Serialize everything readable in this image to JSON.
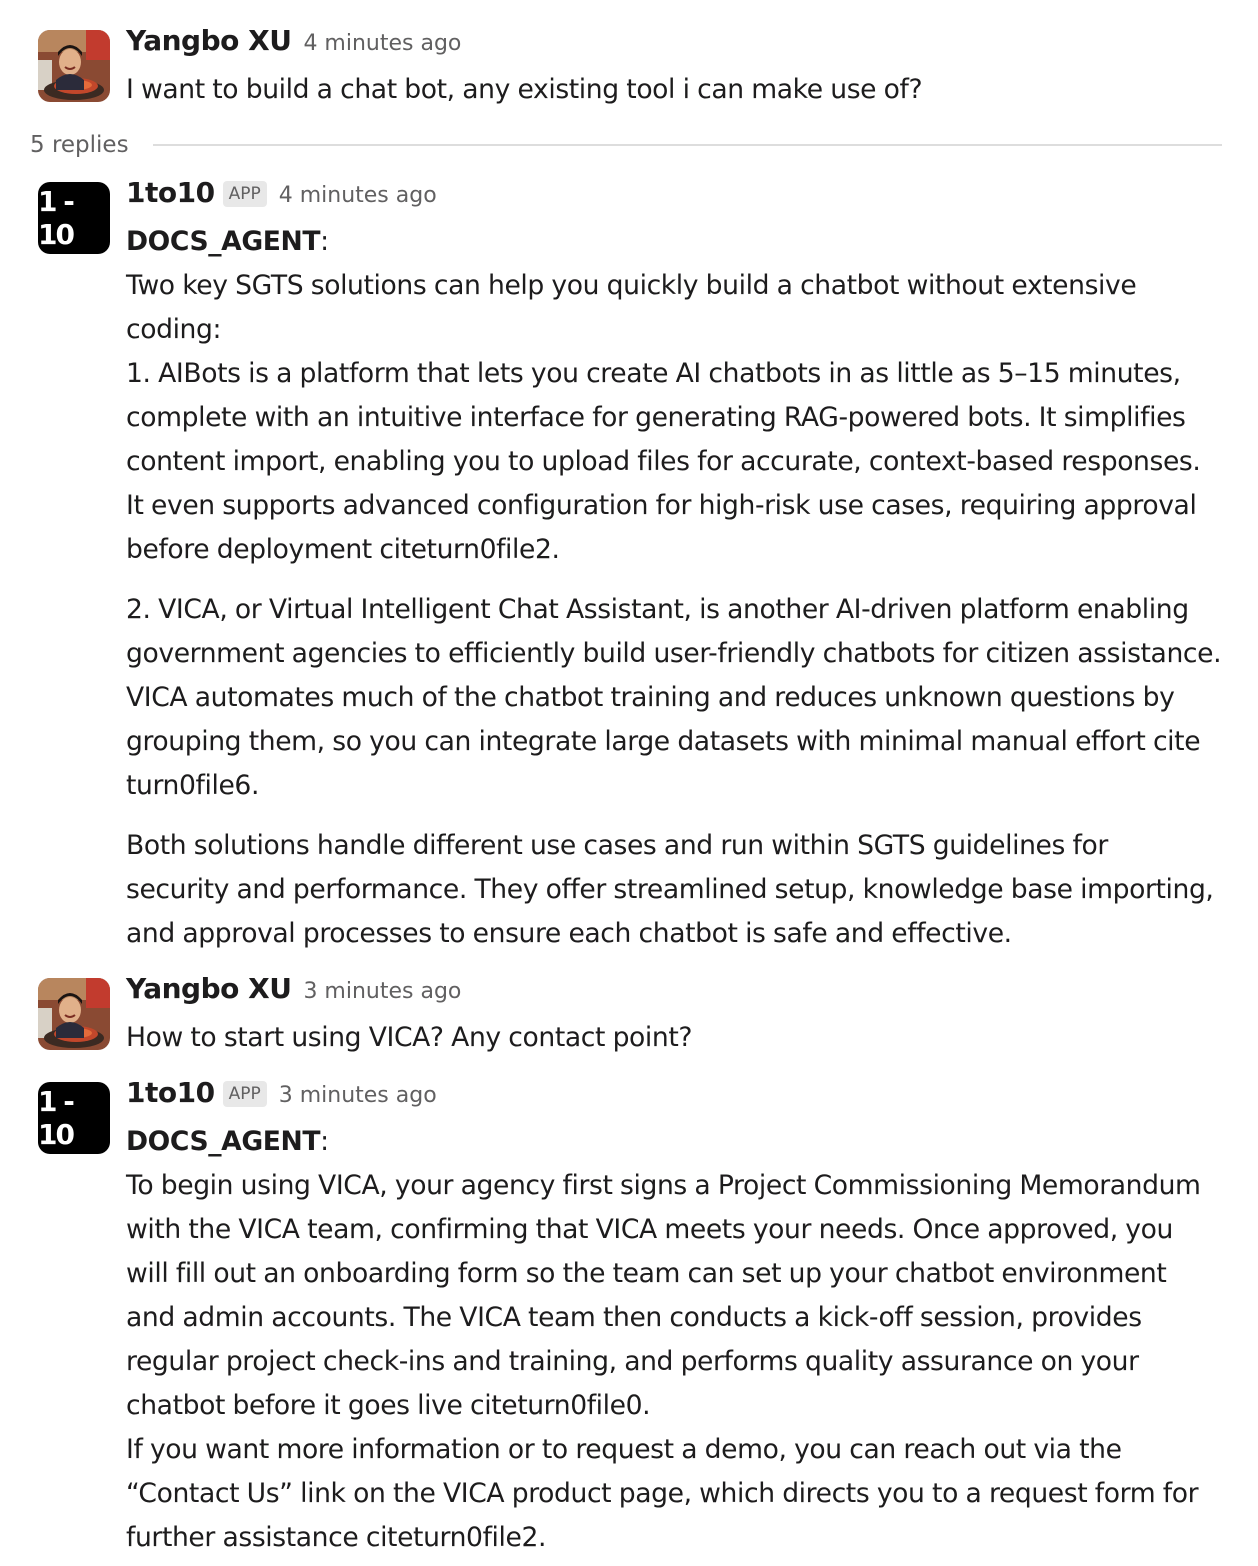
{
  "thread": {
    "parent": {
      "author": "Yangbo XU",
      "time": "4 minutes ago",
      "text": "I want to build a chat bot, any existing tool i can make use of?"
    },
    "replies_label": "5 replies"
  },
  "bot": {
    "avatar_text": "1 - 10",
    "name": "1to10",
    "badge": "APP"
  },
  "reply1": {
    "time": "4 minutes ago",
    "agent": "DOCS_AGENT",
    "colon": ":",
    "lines": [
      "Two key SGTS solutions can help you quickly build a chatbot without extensive",
      "coding:",
      "1. AIBots is a platform that lets you create AI chatbots in as little as 5–15 minutes,",
      "complete with an intuitive interface for generating RAG-powered bots. It simplifies",
      "content import, enabling you to upload files for accurate, context-based responses.",
      "It even supports advanced configuration for high-risk use cases, requiring approval",
      "before deployment citeturn0file2."
    ],
    "lines2": [
      "2. VICA, or Virtual Intelligent Chat Assistant, is another AI-driven platform enabling",
      "government agencies to efficiently build user-friendly chatbots for citizen assistance.",
      "VICA automates much of the chatbot training and reduces unknown questions by",
      "grouping them, so you can integrate large datasets with minimal manual effort cite",
      "turn0file6."
    ],
    "lines3": [
      "Both solutions handle different use cases and run within SGTS guidelines for",
      "security and performance. They offer streamlined setup, knowledge base importing,",
      "and approval processes to ensure each chatbot is safe and effective."
    ]
  },
  "reply2": {
    "author": "Yangbo XU",
    "time": "3 minutes ago",
    "text": "How to start using VICA? Any contact point?"
  },
  "reply3": {
    "time": "3 minutes ago",
    "agent": "DOCS_AGENT",
    "colon": ":",
    "lines": [
      "To begin using VICA, your agency first signs a Project Commissioning Memorandum",
      "with the VICA team, confirming that VICA meets your needs. Once approved, you",
      "will fill out an onboarding form so the team can set up your chatbot environment",
      "and admin accounts. The VICA team then conducts a kick-off session, provides",
      "regular project check-ins and training, and performs quality assurance on your",
      "chatbot before it goes live citeturn0file0.",
      "If you want more information or to request a demo, you can reach out via the",
      "“Contact Us” link on the VICA product page, which directs you to a request form for",
      "further assistance citeturn0file2."
    ]
  }
}
